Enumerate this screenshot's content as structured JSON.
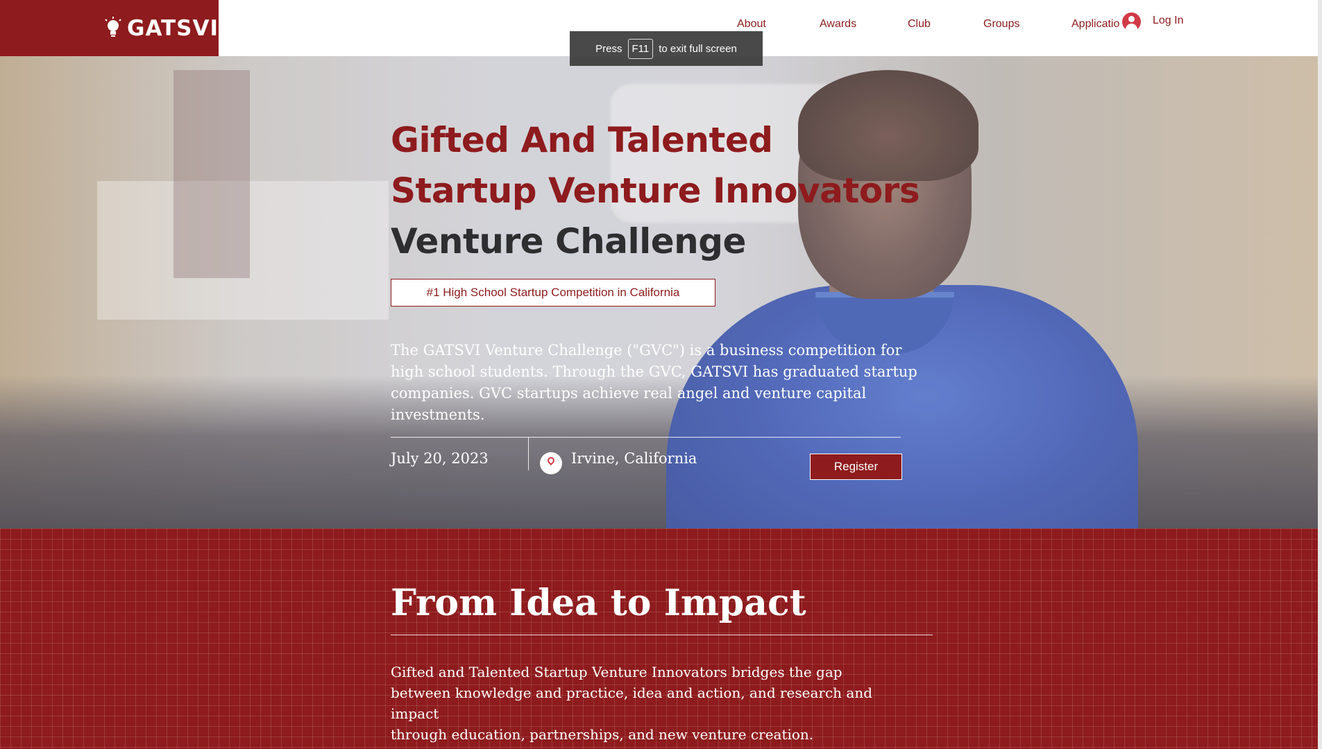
{
  "header": {
    "logo_text": "GATSVI",
    "nav": [
      {
        "label": "About"
      },
      {
        "label": "Awards"
      },
      {
        "label": "Club"
      },
      {
        "label": "Groups"
      },
      {
        "label": "Applicatio"
      }
    ],
    "login_label": "Log In"
  },
  "toast": {
    "prefix": "Press",
    "key": "F11",
    "suffix": "to exit full screen"
  },
  "hero": {
    "title_line1": "Gifted And Talented",
    "title_line2": "Startup Venture Innovators",
    "title_line3": "Venture Challenge",
    "tagline": "#1 High School Startup Competition in California",
    "intro": "The GATSVI Venture Challenge (\"GVC\") is a business competition for high school students. Through the GVC, GATSVI has graduated startup companies. GVC startups achieve real angel and venture capital investments.",
    "date": "July 20, 2023",
    "location": "Irvine, California",
    "register_label": "Register"
  },
  "section": {
    "title": "From Idea to Impact",
    "body_lines": [
      "Gifted and Talented Startup Venture Innovators bridges the gap",
      "between knowledge and practice, idea and action, and research and impact",
      "through education, partnerships, and new venture creation."
    ]
  },
  "colors": {
    "brand": "#8e1b1d",
    "dark_text": "#2e2e30",
    "login_avatar": "#d13a47"
  }
}
